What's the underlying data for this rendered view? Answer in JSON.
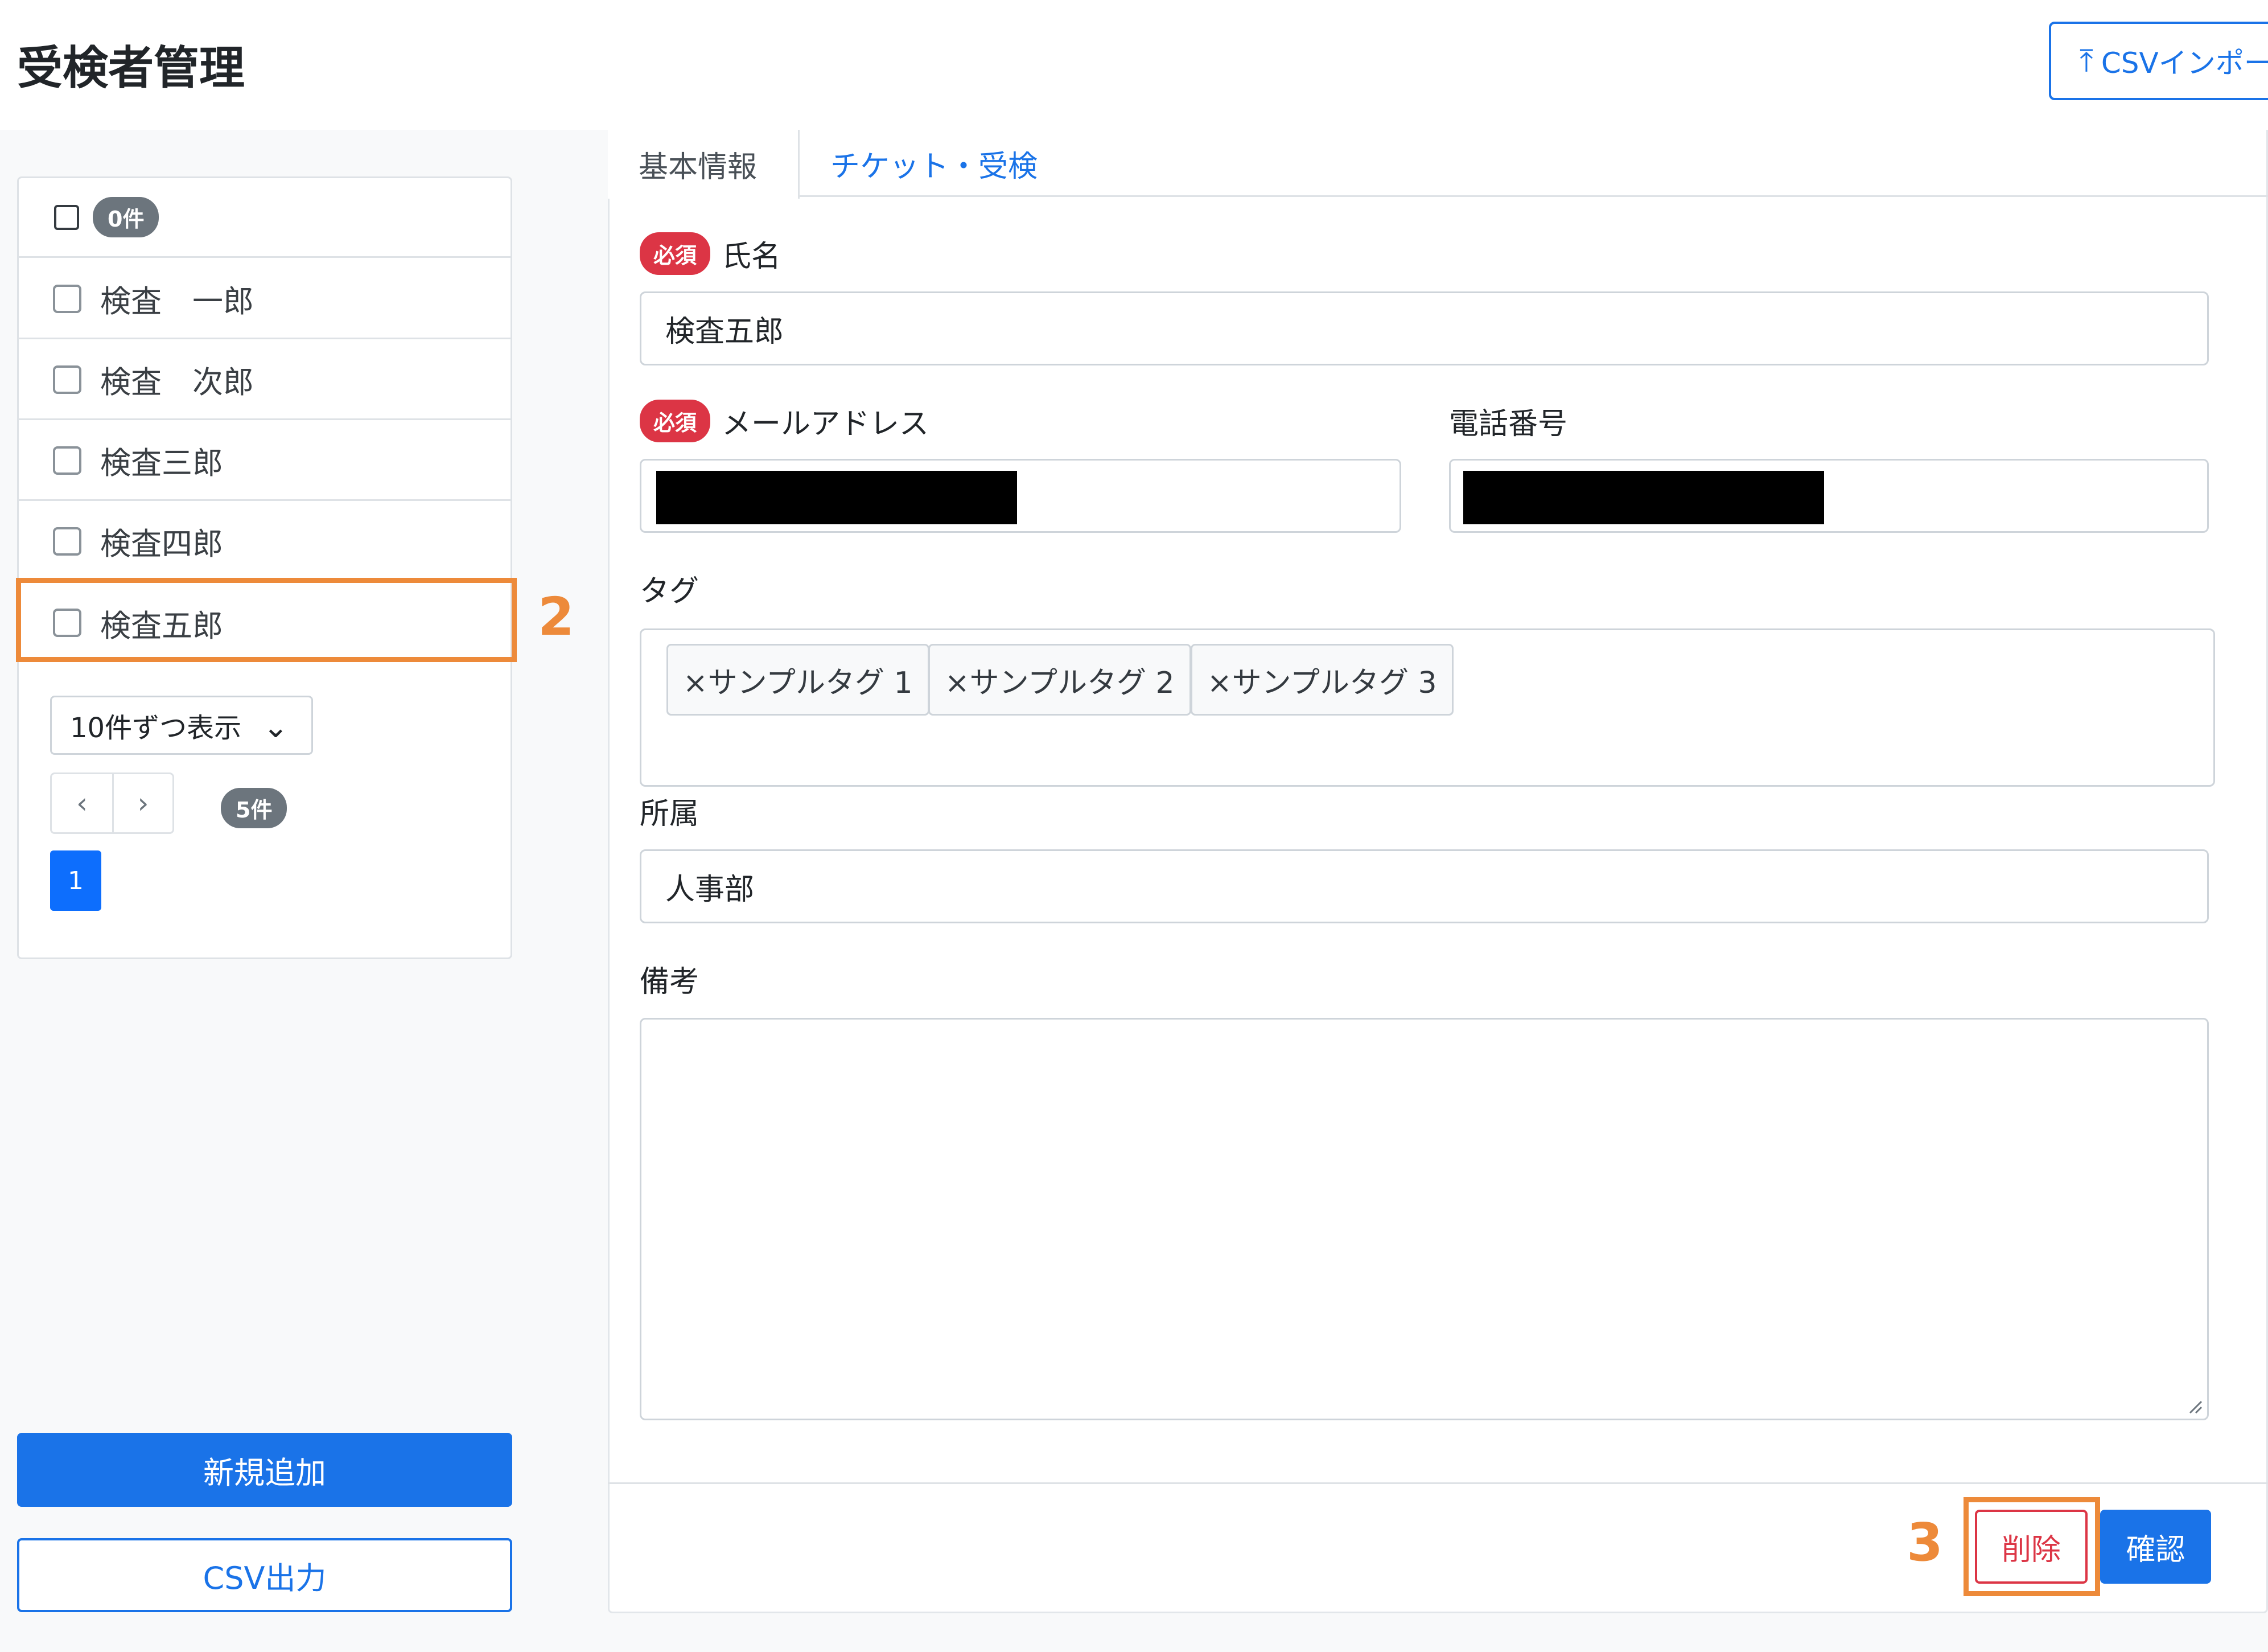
{
  "header": {
    "title": "受検者管理",
    "csv_import_label": "CSVインポート",
    "csv_import_icon": "upload-arrow-icon"
  },
  "list": {
    "select_all_count": "0件",
    "items": [
      {
        "label": "検査　一郎"
      },
      {
        "label": "検査　次郎"
      },
      {
        "label": "検査三郎"
      },
      {
        "label": "検査四郎"
      },
      {
        "label": "検査五郎"
      }
    ],
    "page_size": "10件ずつ表示",
    "prev": "‹",
    "next": "›",
    "total_count": "5件",
    "current_page": "1"
  },
  "actions": {
    "add_new": "新規追加",
    "csv_export": "CSV出力"
  },
  "tabs": [
    {
      "label": "基本情報",
      "active": true
    },
    {
      "label": "チケット・受検",
      "active": false
    }
  ],
  "form": {
    "required_badge": "必須",
    "name_label": "氏名",
    "name_value": "検査五郎",
    "email_label": "メールアドレス",
    "phone_label": "電話番号",
    "tag_label": "タグ",
    "tags": [
      "×サンプルタグ 1",
      "×サンプルタグ 2",
      "×サンプルタグ 3"
    ],
    "department_label": "所属",
    "department_value": "人事部",
    "notes_label": "備考",
    "notes_value": ""
  },
  "footer": {
    "delete_label": "削除",
    "confirm_label": "確認"
  },
  "annotations": {
    "step_2": "2",
    "step_3": "3"
  },
  "colors": {
    "primary": "#1a73e8",
    "danger": "#dc3545",
    "annotation": "#ed8a3a",
    "badge_gray": "#6c757d"
  }
}
